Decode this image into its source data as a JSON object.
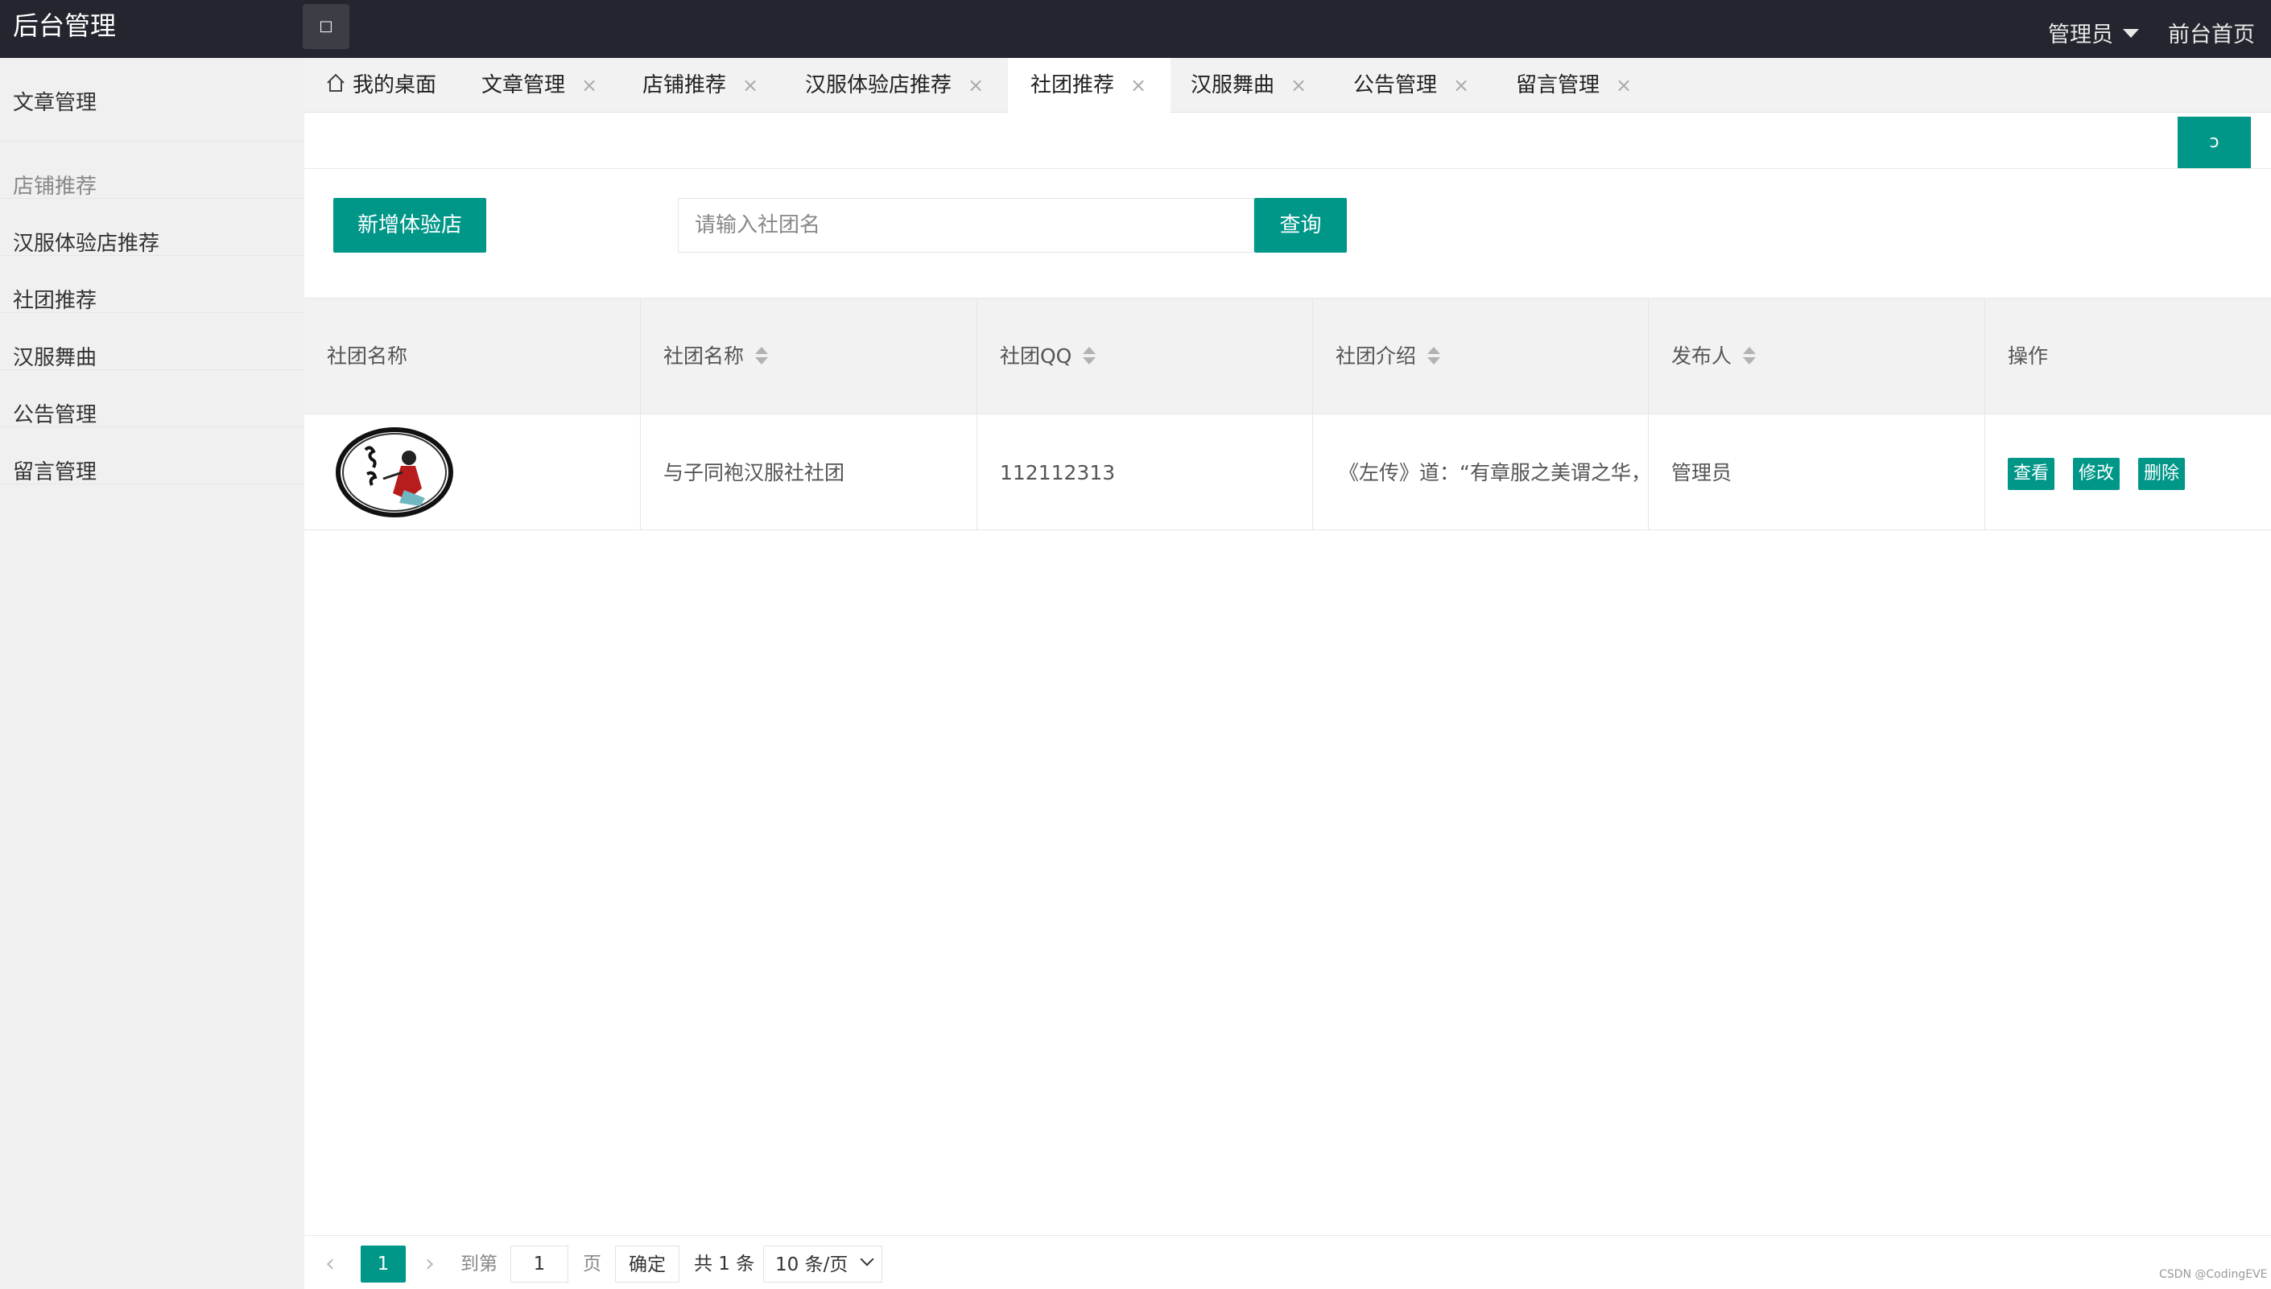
{
  "header": {
    "logo": "后台管理",
    "menu_toggle_icon": "□",
    "user": "管理员",
    "front_link": "前台首页"
  },
  "sidebar": {
    "items": [
      {
        "label": "文章管理"
      },
      {
        "label": "店铺推荐"
      },
      {
        "label": "汉服体验店推荐"
      },
      {
        "label": "社团推荐"
      },
      {
        "label": "汉服舞曲"
      },
      {
        "label": "公告管理"
      },
      {
        "label": "留言管理"
      }
    ]
  },
  "tabs": [
    {
      "label": "我的桌面",
      "icon": "home-icon"
    },
    {
      "label": "文章管理",
      "close": "×"
    },
    {
      "label": "店铺推荐",
      "close": "×"
    },
    {
      "label": "汉服体验店推荐",
      "close": "×"
    },
    {
      "label": "社团推荐",
      "close": "×",
      "active": true
    },
    {
      "label": "汉服舞曲",
      "close": "×"
    },
    {
      "label": "公告管理",
      "close": "×"
    },
    {
      "label": "留言管理",
      "close": "×"
    }
  ],
  "toolbar": {
    "refresh_icon": "refresh-icon",
    "refresh_glyph": "ↄ",
    "add_label": "新增体验店",
    "search_placeholder": "请输入社团名",
    "search_value": "",
    "query_label": "查询"
  },
  "table": {
    "columns": [
      "社团名称",
      "社团名称",
      "社团QQ",
      "社团介绍",
      "发布人",
      "操作"
    ],
    "rows": [
      {
        "image_alt": "社团图片",
        "name": "与子同袍汉服社社团",
        "qq": "112112313",
        "intro": "《左传》道：“有章服之美谓之华，有",
        "publisher": "管理员",
        "actions": [
          "查看",
          "修改",
          "删除"
        ]
      }
    ]
  },
  "pagination": {
    "prev": "‹",
    "current": "1",
    "next": "›",
    "goto_label": "到第",
    "goto_value": "1",
    "page_unit": "页",
    "confirm": "确定",
    "total": "共 1 条",
    "page_size": "10 条/页"
  },
  "colors": {
    "accent": "#009688",
    "topbar": "#23262e",
    "sidebar": "#f0f0f0"
  },
  "watermark": "CSDN @CodingEVE"
}
